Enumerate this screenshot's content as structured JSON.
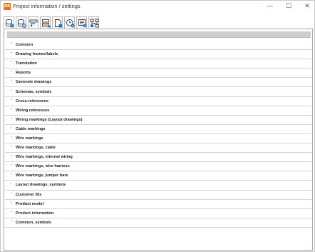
{
  "window": {
    "title": "Project information / settings",
    "logo_text": "DB",
    "minimize_glyph": "—",
    "maximize_glyph": "☐",
    "close_glyph": "✕"
  },
  "toolbar": {
    "tabs": [
      {
        "icon": "database-info-icon",
        "active": true
      },
      {
        "icon": "database-settings-icon",
        "active": false
      },
      {
        "icon": "translate-icon",
        "active": false
      },
      {
        "icon": "reports-icon",
        "active": false
      },
      {
        "icon": "document-icon",
        "active": false
      },
      {
        "icon": "clock-settings-icon",
        "active": false
      },
      {
        "icon": "list-settings-icon",
        "active": false
      },
      {
        "icon": "tree-structure-icon",
        "active": false
      }
    ]
  },
  "sections": [
    "Common",
    "Drawing frames/labels",
    "Translation",
    "Reports",
    "Generate drawings",
    "Schemas, symbols",
    "Cross-references",
    "Wiring references",
    "Wiring markings (Layout drawings)",
    "Cable markings",
    "Wire markings",
    "Wire markings, cable",
    "Wire markings, internal wiring",
    "Wire markings, wire harness",
    "Wire markings, jumper bars",
    "Layout drawings, symbols",
    "Customer IDs",
    "Product model",
    "Product information",
    "Common, symbols"
  ],
  "chevron_glyph": "˅"
}
